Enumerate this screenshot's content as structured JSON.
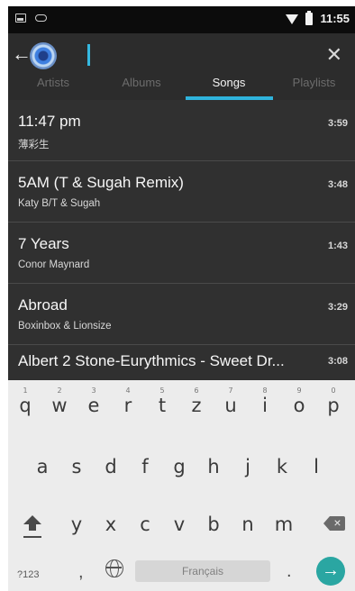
{
  "status_bar": {
    "time": "11:55",
    "icons": [
      "image-icon",
      "chat-icon",
      "wifi-icon",
      "battery-icon"
    ]
  },
  "toolbar": {
    "back_icon": "arrow-left-icon",
    "search_value": "",
    "clear_icon": "close-icon",
    "accent_color": "#2fb3dc"
  },
  "tabs": [
    {
      "label": "Artists"
    },
    {
      "label": "Albums"
    },
    {
      "label": "Songs",
      "selected": true
    },
    {
      "label": "Playlists"
    }
  ],
  "songs": [
    {
      "title": "11:47 pm",
      "artist": "薄彩生",
      "duration": "3:59"
    },
    {
      "title": "5AM (T & Sugah Remix)",
      "artist": "Katy B/T & Sugah",
      "duration": "3:48"
    },
    {
      "title": "7 Years",
      "artist": "Conor Maynard",
      "duration": "1:43"
    },
    {
      "title": "Abroad",
      "artist": "Boxinbox & Lionsize",
      "duration": "3:29"
    },
    {
      "title": "Albert 2 Stone-Eurythmics - Sweet Dr...",
      "duration": "3:08"
    }
  ],
  "keyboard": {
    "row1": [
      {
        "key": "q",
        "hint": "1"
      },
      {
        "key": "w",
        "hint": "2"
      },
      {
        "key": "e",
        "hint": "3"
      },
      {
        "key": "r",
        "hint": "4"
      },
      {
        "key": "t",
        "hint": "5"
      },
      {
        "key": "z",
        "hint": "6"
      },
      {
        "key": "u",
        "hint": "7"
      },
      {
        "key": "i",
        "hint": "8"
      },
      {
        "key": "o",
        "hint": "9"
      },
      {
        "key": "p",
        "hint": "0"
      }
    ],
    "row2": [
      "a",
      "s",
      "d",
      "f",
      "g",
      "h",
      "j",
      "k",
      "l"
    ],
    "row3": [
      "y",
      "x",
      "c",
      "v",
      "b",
      "n",
      "m"
    ],
    "numbers_label": "?123",
    "comma": ",",
    "space_label": "Français",
    "period": ".",
    "enter_icon": "arrow-right-icon",
    "enter_color": "#2aa6a2"
  }
}
